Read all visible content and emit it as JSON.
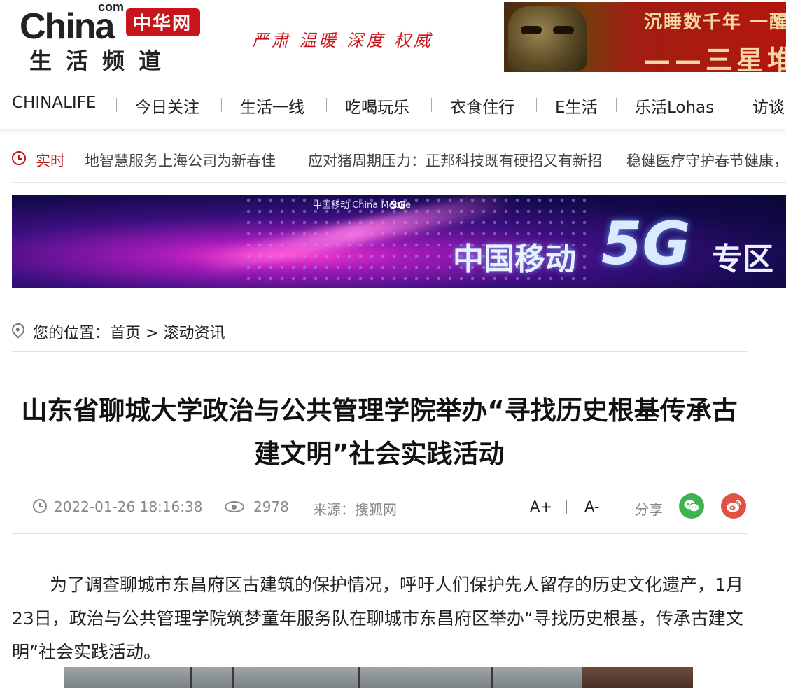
{
  "header": {
    "logo": {
      "china": "China",
      "com": "com",
      "cn_name": "中华网",
      "channel": "生活频道"
    },
    "slogan": "严肃 温暖 深度 权威",
    "ad": {
      "line1": "沉睡数千年 一醒",
      "line2": "——三星堆"
    }
  },
  "nav": {
    "items": [
      "CHINALIFE",
      "今日关注",
      "生活一线",
      "吃喝玩乐",
      "衣食住行",
      "E生活",
      "乐活Lohas",
      "访谈"
    ]
  },
  "ticker": {
    "label": "实时",
    "items": [
      "地智慧服务上海公司为新春佳",
      "应对猪周期压力：正邦科技既有硬招又有新招",
      "稳健医疗守护春节健康，"
    ]
  },
  "banner": {
    "brand": "中国移动 China Mobile",
    "brand_5g": "5G",
    "title_prefix": "中国移动",
    "title_5g": "5G",
    "title_suffix": "专区"
  },
  "breadcrumb": {
    "label": "您的位置：",
    "home": "首页",
    "separator": ">",
    "section": "滚动资讯"
  },
  "article": {
    "title": "山东省聊城大学政治与公共管理学院举办“寻找历史根基传承古建文明”社会实践活动",
    "datetime": "2022-01-26 18:16:38",
    "views": "2978",
    "source": "来源：搜狐网",
    "font_increase": "A+",
    "font_decrease": "A-",
    "share_label": "分享",
    "body": "为了调查聊城市东昌府区古建筑的保护情况，呼吁人们保护先人留存的历史文化遗产，1月23日，政治与公共管理学院筑梦童年服务队在聊城市东昌府区举办“寻找历史根基，传承古建文明”社会实践活动。"
  },
  "colors": {
    "brand_red": "#c8151b",
    "wechat_green": "#3fb34f",
    "weibo_red": "#e05244"
  }
}
